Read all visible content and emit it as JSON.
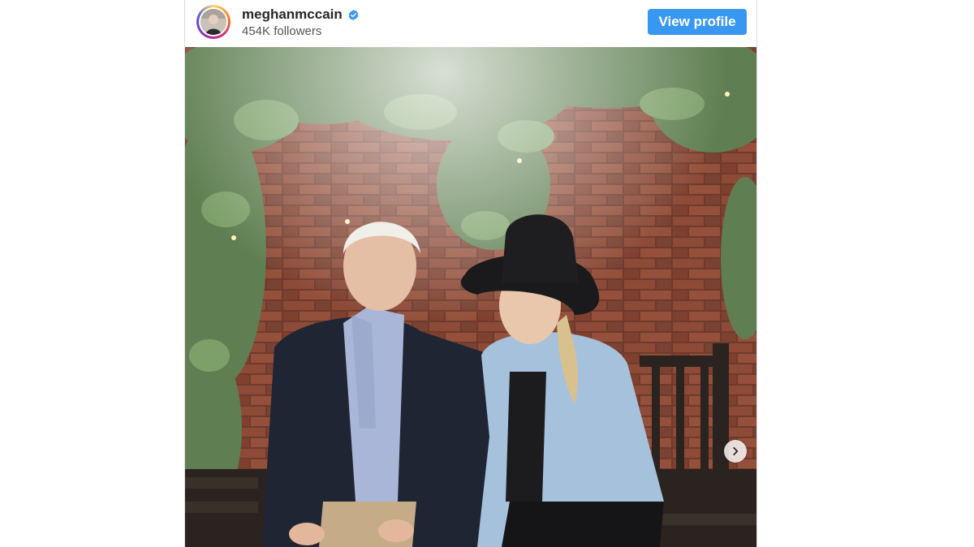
{
  "post": {
    "username": "meghanmccain",
    "followers": "454K followers",
    "verified": true,
    "view_profile_label": "View profile",
    "photo_alt": "Photo post"
  },
  "colors": {
    "accent": "#3897f0",
    "verified": "#3897f0",
    "username": "#262626",
    "secondary_text": "#555555"
  },
  "icons": {
    "verified": "verified-badge-icon",
    "next": "chevron-right-icon"
  }
}
